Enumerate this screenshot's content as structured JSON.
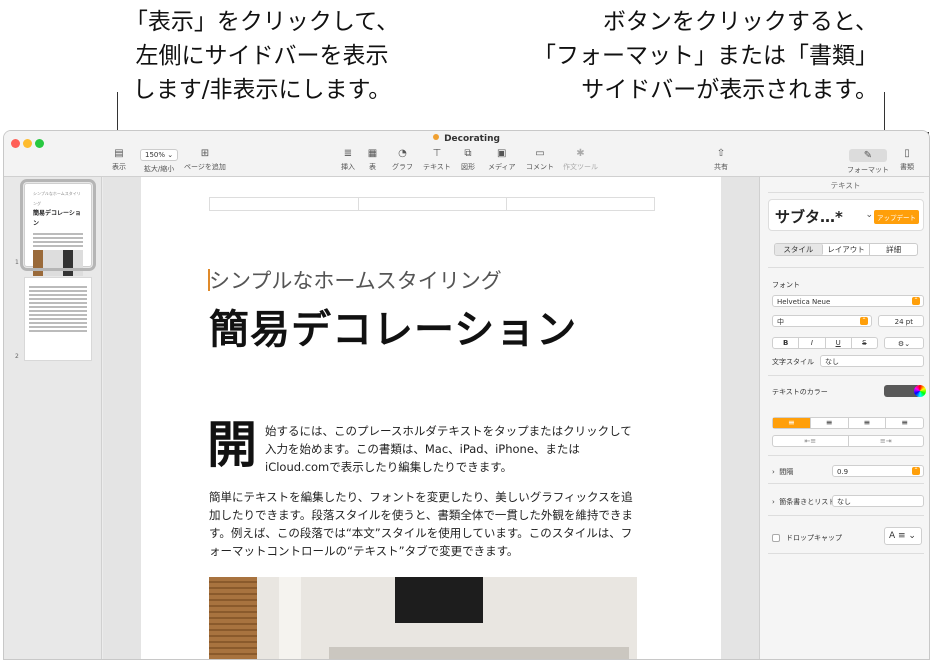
{
  "callouts": {
    "left": [
      "「表示」をクリックして、",
      "左側にサイドバーを表示",
      "します/非表示にします。"
    ],
    "right": [
      "ボタンをクリックすると、",
      "「フォーマット」または「書類」",
      "サイドバーが表示されます。"
    ]
  },
  "window": {
    "title": "Decorating"
  },
  "toolbar": {
    "view": "表示",
    "zoom_value": "150%",
    "zoom": "拡大/縮小",
    "add_page": "ページを追加",
    "insert": "挿入",
    "table": "表",
    "chart": "グラフ",
    "text": "テキスト",
    "shape": "図形",
    "media": "メディア",
    "comment": "コメント",
    "writing_tools": "作文ツール",
    "share": "共有",
    "format": "フォーマット",
    "document": "書類"
  },
  "sidebar": {
    "pages": [
      {
        "number": "1",
        "title": "簡易デコレーション"
      },
      {
        "number": "2",
        "title": ""
      }
    ]
  },
  "document": {
    "subtitle": "シンプルなホームスタイリング",
    "title": "簡易デコレーション",
    "dropcap": "開",
    "para1": "始するには、このプレースホルダテキストをタップまたはクリックして入力を始めます。この書類は、Mac、iPad、iPhone、またはiCloud.comで表示したり編集したりできます。",
    "para2": "簡単にテキストを編集したり、フォントを変更したり、美しいグラフィックスを追加したりできます。段落スタイルを使うと、書類全体で一貫した外観を維持できます。例えば、この段落では“本文”スタイルを使用しています。このスタイルは、フォーマットコントロールの“テキスト”タブで変更できます。"
  },
  "inspector": {
    "title": "テキスト",
    "style_name": "サブタ…*",
    "update_button": "アップデート",
    "tabs": [
      "スタイル",
      "レイアウト",
      "詳細"
    ],
    "font_label": "フォント",
    "font_family": "Helvetica Neue",
    "font_weight": "中",
    "font_size": "24 pt",
    "bius": [
      "B",
      "I",
      "U",
      "S"
    ],
    "char_style_label": "文字スタイル",
    "char_style_value": "なし",
    "text_color_label": "テキストのカラー",
    "spacing_label": "間隔",
    "spacing_value": "0.9",
    "list_label": "箇条書きとリスト",
    "list_value": "なし",
    "dropcap_label": "ドロップキャップ",
    "dropcap_sample": "A"
  },
  "colors": {
    "accent": "#ff9f0a",
    "text_color": "#595959"
  }
}
